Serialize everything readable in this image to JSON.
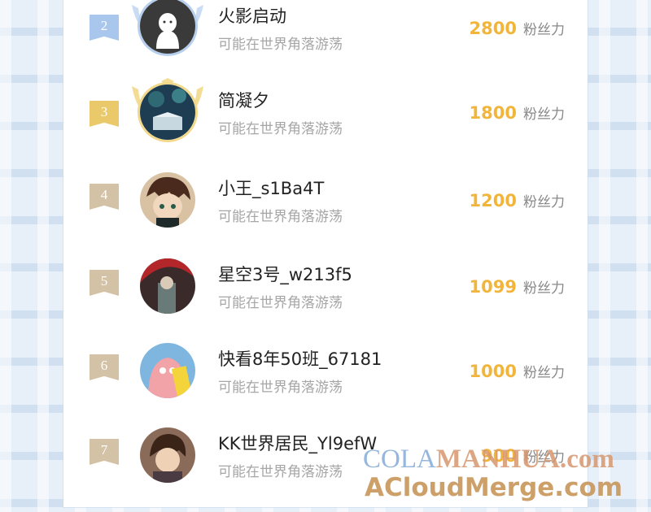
{
  "ranking": [
    {
      "rank": "2",
      "name": "火影启动",
      "subtitle": "可能在世界角落游荡",
      "fans": "2800",
      "fans_unit": "粉丝力",
      "badge_color": "#a9c7ec",
      "avatar": "ghost-avatar"
    },
    {
      "rank": "3",
      "name": "简凝夕",
      "subtitle": "可能在世界角落游荡",
      "fans": "1800",
      "fans_unit": "粉丝力",
      "badge_color": "#e9c969",
      "avatar": "book-scene-avatar"
    },
    {
      "rank": "4",
      "name": "小王_s1Ba4T",
      "subtitle": "可能在世界角落游荡",
      "fans": "1200",
      "fans_unit": "粉丝力",
      "badge_color": "#d3c2a5",
      "avatar": "anime-boy-avatar"
    },
    {
      "rank": "5",
      "name": "星空3号_w213f5",
      "subtitle": "可能在世界角落游荡",
      "fans": "1099",
      "fans_unit": "粉丝力",
      "badge_color": "#d3c2a5",
      "avatar": "red-umbrella-avatar"
    },
    {
      "rank": "6",
      "name": "快看8年50班_67181",
      "subtitle": "可能在世界角落游荡",
      "fans": "1000",
      "fans_unit": "粉丝力",
      "badge_color": "#d3c2a5",
      "avatar": "patrick-star-avatar"
    },
    {
      "rank": "7",
      "name": "KK世界居民_Yl9efW",
      "subtitle": "可能在世界角落游荡",
      "fans": "900",
      "fans_unit": "粉丝力",
      "badge_color": "#d3c2a5",
      "avatar": "anime-man-avatar"
    }
  ],
  "watermark": {
    "part1": "COLA",
    "part2": "MANHUA.com",
    "line2": "ACloudMerge.com"
  }
}
